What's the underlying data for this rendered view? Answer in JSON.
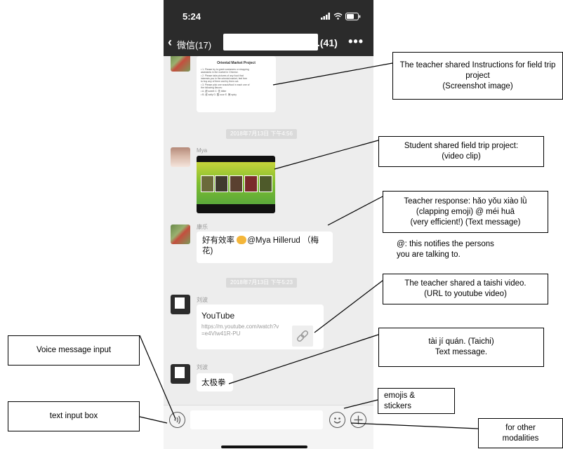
{
  "status_bar": {
    "time": "5:24",
    "icons": [
      "signal-icon",
      "wifi-icon",
      "battery-icon"
    ]
  },
  "header": {
    "back_label": "微信(17)",
    "title_suffix": ".(41)",
    "more_label": "•••"
  },
  "messages": {
    "doc": {
      "title": "Oriental Market Project",
      "lines": [
        "• 1. Please try to greet customers or shopping",
        "   assistants in the market in Chinese.",
        "• 2. Please take pictures of any food that",
        "   interests you in the oriental market, feel free",
        "   to buy any of them and try them out.",
        "• 3. Please pick one snack/food in each one of",
        "   the following flavors:",
        "• A. 甜 sweet     C. 苦  bitter",
        "• B. 咸  salty     D. 酸 sour     E. 辣 spicy"
      ]
    },
    "timestamp_1": "2018年7月13日 下午4:56",
    "video_sender": "Mya",
    "efficient_sender": "康乐",
    "efficient_text": "好有效率 @Mya Hillerud （梅花)",
    "timestamp_2": "2018年7月13日 下午5:23",
    "link_sender": "刘波",
    "link_title": "YouTube",
    "link_url": "https://m.youtube.com/watch?v=e4VIw41R-PU",
    "taichi_sender": "刘波",
    "taichi_text": "太极拳"
  },
  "input_bar": {
    "placeholder": ""
  },
  "annotations": {
    "instructions": "The teacher shared Instructions for field trip project\n(Screenshot image)",
    "student_video": "Student shared field trip project:\n(video clip)",
    "teacher_response": "Teacher response: hǎo yǒu xiào lǜ\n(clapping emoji) @ méi huā\n(very efficient!) (Text message)",
    "at_note": "@: this notifies the persons\nyou are talking to.",
    "taishi_video": "The teacher shared a taishi video.\n(URL to youtube video)",
    "taichi_text": "tài jí quán. (Taichi)\nText message.",
    "voice_input": "Voice message input",
    "text_input": "text input box",
    "emojis": "emojis &\nstickers",
    "other_modalities": "for other\nmodalities"
  }
}
